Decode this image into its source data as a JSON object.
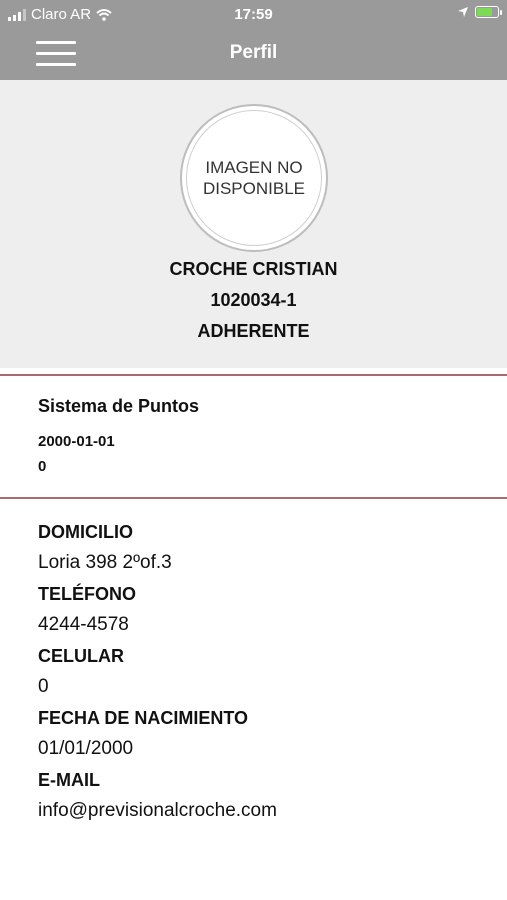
{
  "status": {
    "carrier": "Claro AR",
    "time": "17:59"
  },
  "nav": {
    "title": "Perfil"
  },
  "profile": {
    "avatar_text_1": "IMAGEN NO",
    "avatar_text_2": "DISPONIBLE",
    "name": "CROCHE CRISTIAN",
    "member_id": "1020034-1",
    "member_type": "ADHERENTE"
  },
  "points": {
    "title": "Sistema de Puntos",
    "date": "2000-01-01",
    "value": "0"
  },
  "details": {
    "address_label": "DOMICILIO",
    "address": "Loria 398  2ºof.3",
    "phone_label": "TELÉFONO",
    "phone": "4244-4578",
    "mobile_label": "CELULAR",
    "mobile": "0",
    "birth_label": "FECHA DE NACIMIENTO",
    "birth": "01/01/2000",
    "email_label": "E-MAIL",
    "email": "info@previsionalcroche.com"
  },
  "colors": {
    "header": "#9a9a9a",
    "profile_bg": "#eeeeee",
    "divider": "#a86b6b"
  }
}
